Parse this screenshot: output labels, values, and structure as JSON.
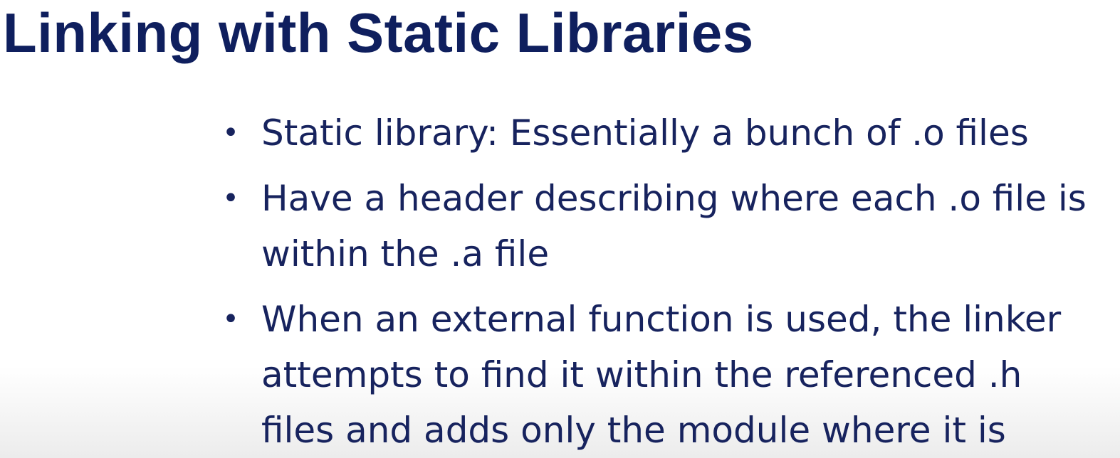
{
  "slide": {
    "title": "Linking with Static Libraries",
    "bullets": [
      {
        "lines": [
          "Static library: Essentially a bunch of .o files"
        ]
      },
      {
        "lines": [
          "Have a header describing where each .o file is",
          "within the .a file"
        ]
      },
      {
        "lines": [
          "When an external function is used, the linker",
          "attempts to find it within the referenced .h",
          "files and adds only the module where it is"
        ]
      }
    ],
    "bullet_symbol": "•",
    "colors": {
      "title": "#0f1f5e",
      "text": "#17235e",
      "background": "#ffffff"
    }
  }
}
